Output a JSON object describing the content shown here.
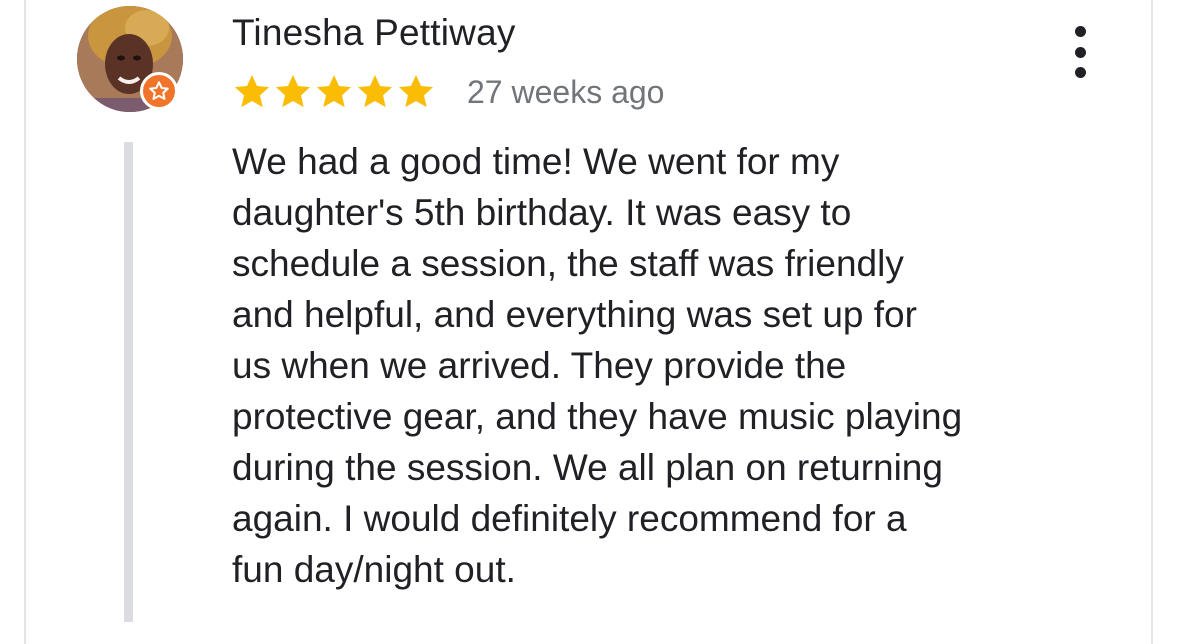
{
  "review": {
    "reviewer_name": "Tinesha Pettiway",
    "rating": 5,
    "rating_max": 5,
    "time_ago": "27 weeks ago",
    "text_lines": [
      "We had a good time! We went for my",
      "daughter's 5th birthday. It was easy to",
      "schedule a session, the staff was friendly",
      "and helpful, and everything was set up for",
      "us when we arrived. They provide the",
      "protective gear, and they have music playing",
      "during the session. We all plan on returning",
      "again. I would definitely recommend for a",
      "fun day/night out."
    ]
  },
  "icons": {
    "avatar": "avatar",
    "guide_badge": "local-guide-star-icon",
    "star": "star-icon",
    "more": "more-vert-icon"
  },
  "colors": {
    "star": "#fbbc04",
    "badge": "#f0752a",
    "text": "#202124",
    "muted": "#70757a",
    "quote_bar": "#dadce0"
  }
}
